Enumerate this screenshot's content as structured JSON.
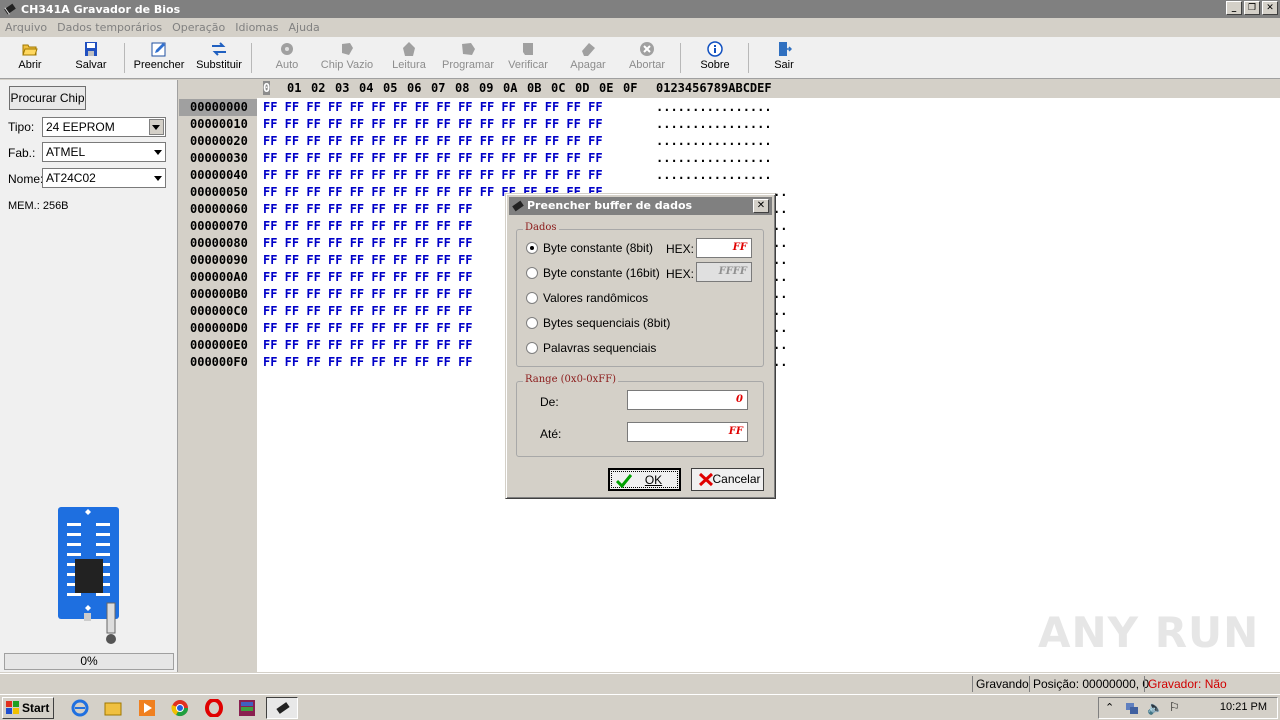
{
  "window": {
    "title": "CH341A Gravador de Bios"
  },
  "menu": [
    "Arquivo",
    "Dados temporários",
    "Operação",
    "Idiomas",
    "Ajuda"
  ],
  "toolbar": {
    "abrir": "Abrir",
    "salvar": "Salvar",
    "preencher": "Preencher",
    "substituir": "Substituir",
    "auto": "Auto",
    "chip_vazio": "Chip Vazio",
    "leitura": "Leitura",
    "programar": "Programar",
    "verificar": "Verificar",
    "apagar": "Apagar",
    "abortar": "Abortar",
    "sobre": "Sobre",
    "sair": "Sair"
  },
  "left": {
    "search_button": "Procurar Chip",
    "tipo_label": "Tipo:",
    "tipo_value": "24 EEPROM",
    "fab_label": "Fab.:",
    "fab_value": "ATMEL",
    "nome_label": "Nome:",
    "nome_value": "AT24C02",
    "mem": "MEM.: 256B",
    "progress": "0%"
  },
  "hex": {
    "columns": [
      "0",
      "01",
      "02",
      "03",
      "04",
      "05",
      "06",
      "07",
      "08",
      "09",
      "0A",
      "0B",
      "0C",
      "0D",
      "0E",
      "0F"
    ],
    "cursor_char": "0",
    "ascii_header": "0123456789ABCDEF",
    "addresses": [
      "00000000",
      "00000010",
      "00000020",
      "00000030",
      "00000040",
      "00000050",
      "00000060",
      "00000070",
      "00000080",
      "00000090",
      "000000A0",
      "000000B0",
      "000000C0",
      "000000D0",
      "000000E0",
      "000000F0"
    ],
    "row_full": "FF FF FF FF FF FF FF FF FF FF FF FF FF FF FF FF",
    "row_partial": "FF FF FF FF FF FF FF FF FF FF",
    "row_mid": "FF FF FF FF FF FF FF FF FF FF FF FF FF FF FF FF",
    "ascii_full": "................",
    "ascii_tail": ".."
  },
  "dialog": {
    "title": "Preencher buffer de dados",
    "close": "✕",
    "dados_title": "Dados",
    "opt1": "Byte constante (8bit)",
    "opt2": "Byte constante (16bit)",
    "opt3": "Valores randômicos",
    "opt4": "Bytes sequenciais (8bit)",
    "opt5": "Palavras sequenciais",
    "hex_label": "HEX:",
    "hex8_value": "FF",
    "hex16_value": "FFFF",
    "range_title": "Range (0x0-0xFF)",
    "de_label": "De:",
    "de_value": "0",
    "ate_label": "Até:",
    "ate_value": "FF",
    "ok": "OK",
    "cancel": "Cancelar"
  },
  "status": {
    "state": "Gravando",
    "position": "Posição: 00000000, 0",
    "gravador": "Gravador: Não conectado."
  },
  "taskbar": {
    "start": "Start",
    "clock": "10:21 PM"
  },
  "watermark": "ANY RUN"
}
